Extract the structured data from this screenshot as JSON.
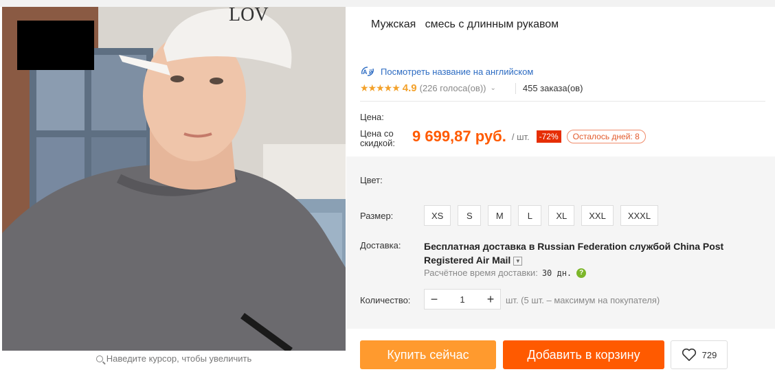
{
  "product": {
    "title": "Мужская   смесь с длинным рукавом",
    "translate_link": "Посмотреть название на английском",
    "translate_icon": "translate-icon",
    "rating_stars": "★★★★★",
    "rating_score": "4.9",
    "votes": "(226 голоса(ов))",
    "orders": "455 заказа(ов)"
  },
  "gallery": {
    "zoom_hint": "Наведите курсор, чтобы увеличить",
    "cap_text": "LOV"
  },
  "pricing": {
    "price_label": "Цена:",
    "discount_label": "Цена со скидкой:",
    "price": "9 699,87 руб.",
    "unit": "/ шт.",
    "discount": "-72%",
    "days_left": "Осталось дней: 8"
  },
  "options": {
    "color_label": "Цвет:",
    "size_label": "Размер:",
    "sizes": [
      "XS",
      "S",
      "M",
      "L",
      "XL",
      "XXL",
      "XXXL"
    ]
  },
  "shipping": {
    "label": "Доставка:",
    "text": "Бесплатная доставка в Russian Federation службой China Post Registered Air Mail",
    "eta_label": "Расчётное время доставки:",
    "eta_value": "30 дн.",
    "help": "?"
  },
  "quantity": {
    "label": "Количество:",
    "value": "1",
    "minus": "−",
    "plus": "+",
    "note": "шт. (5 шт. – максимум на покупателя)"
  },
  "actions": {
    "buy_now": "Купить сейчас",
    "add_to_cart": "Добавить в корзину",
    "wishlist_count": "729"
  },
  "colors": {
    "accent": "#ff5a00",
    "buy": "#ff9a2e",
    "rating": "#f3a12a",
    "badge": "#e62e04",
    "link": "#2c6bc2"
  }
}
